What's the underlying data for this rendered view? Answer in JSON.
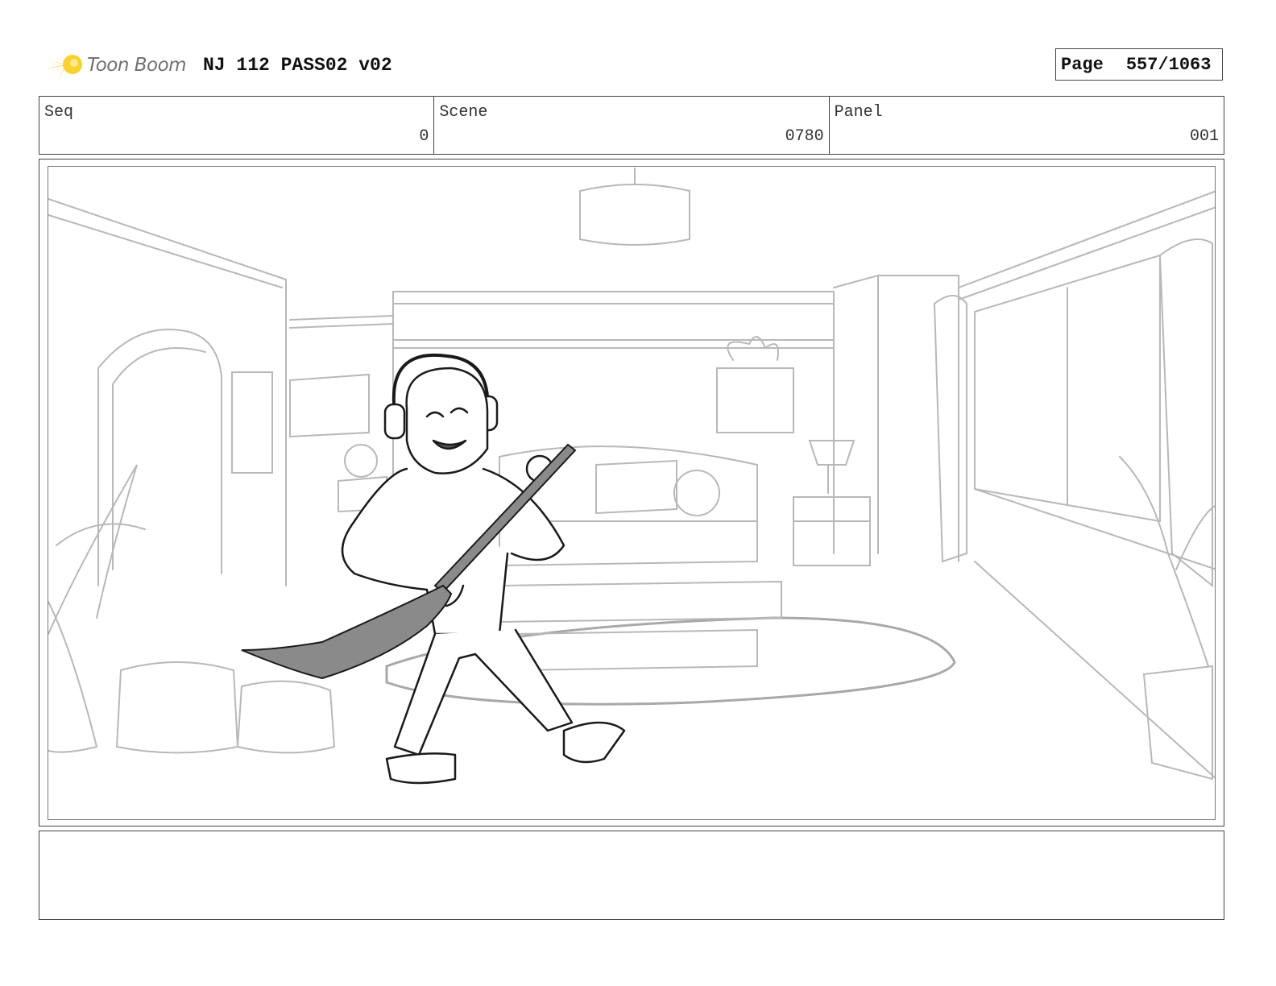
{
  "header": {
    "logo_text": "Toon Boom",
    "title": "NJ 112 PASS02 v02",
    "page_label": "Page",
    "page_value": "557/1063"
  },
  "fields": {
    "seq": {
      "label": "Seq",
      "value": "0"
    },
    "scene": {
      "label": "Scene",
      "value": "0780"
    },
    "panel": {
      "label": "Panel",
      "value": "001"
    }
  },
  "colors": {
    "logo_star": "#f5c400",
    "sketch_background": "#b8b8b8",
    "sketch_character": "#1a1a1a",
    "broom": "#8a8a8a"
  },
  "notes": ""
}
